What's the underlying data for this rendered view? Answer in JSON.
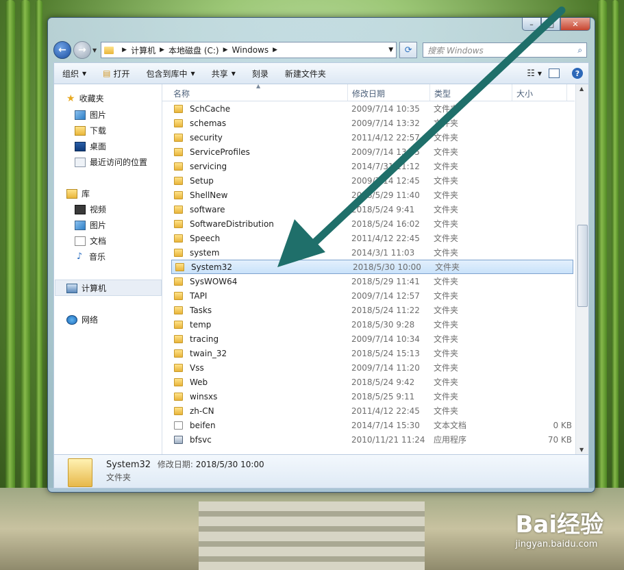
{
  "address": {
    "crumbs": [
      "计算机",
      "本地磁盘 (C:)",
      "Windows"
    ],
    "search_placeholder": "搜索 Windows"
  },
  "toolbar": {
    "organize": "组织",
    "open": "打开",
    "include_library": "包含到库中",
    "share": "共享",
    "burn": "刻录",
    "new_folder": "新建文件夹"
  },
  "nav": {
    "favorites": "收藏夹",
    "pictures": "图片",
    "downloads": "下载",
    "desktop": "桌面",
    "recent": "最近访问的位置",
    "libraries": "库",
    "videos": "视频",
    "lib_pictures": "图片",
    "documents": "文档",
    "music": "音乐",
    "computer": "计算机",
    "network": "网络"
  },
  "columns": {
    "name": "名称",
    "date": "修改日期",
    "type": "类型",
    "size": "大小"
  },
  "files": [
    {
      "name": "SchCache",
      "date": "2009/7/14 10:35",
      "type": "文件夹",
      "size": ""
    },
    {
      "name": "schemas",
      "date": "2009/7/14 13:32",
      "type": "文件夹",
      "size": ""
    },
    {
      "name": "security",
      "date": "2011/4/12 22:57",
      "type": "文件夹",
      "size": ""
    },
    {
      "name": "ServiceProfiles",
      "date": "2009/7/14 13:45",
      "type": "文件夹",
      "size": ""
    },
    {
      "name": "servicing",
      "date": "2014/7/31 11:12",
      "type": "文件夹",
      "size": ""
    },
    {
      "name": "Setup",
      "date": "2009/7/14 12:45",
      "type": "文件夹",
      "size": ""
    },
    {
      "name": "ShellNew",
      "date": "2018/5/29 11:40",
      "type": "文件夹",
      "size": ""
    },
    {
      "name": "software",
      "date": "2018/5/24 9:41",
      "type": "文件夹",
      "size": ""
    },
    {
      "name": "SoftwareDistribution",
      "date": "2018/5/24 16:02",
      "type": "文件夹",
      "size": ""
    },
    {
      "name": "Speech",
      "date": "2011/4/12 22:45",
      "type": "文件夹",
      "size": ""
    },
    {
      "name": "system",
      "date": "2014/3/1 11:03",
      "type": "文件夹",
      "size": ""
    },
    {
      "name": "System32",
      "date": "2018/5/30 10:00",
      "type": "文件夹",
      "size": ""
    },
    {
      "name": "SysWOW64",
      "date": "2018/5/29 11:41",
      "type": "文件夹",
      "size": ""
    },
    {
      "name": "TAPI",
      "date": "2009/7/14 12:57",
      "type": "文件夹",
      "size": ""
    },
    {
      "name": "Tasks",
      "date": "2018/5/24 11:22",
      "type": "文件夹",
      "size": ""
    },
    {
      "name": "temp",
      "date": "2018/5/30 9:28",
      "type": "文件夹",
      "size": ""
    },
    {
      "name": "tracing",
      "date": "2009/7/14 10:34",
      "type": "文件夹",
      "size": ""
    },
    {
      "name": "twain_32",
      "date": "2018/5/24 15:13",
      "type": "文件夹",
      "size": ""
    },
    {
      "name": "Vss",
      "date": "2009/7/14 11:20",
      "type": "文件夹",
      "size": ""
    },
    {
      "name": "Web",
      "date": "2018/5/24 9:42",
      "type": "文件夹",
      "size": ""
    },
    {
      "name": "winsxs",
      "date": "2018/5/25 9:11",
      "type": "文件夹",
      "size": ""
    },
    {
      "name": "zh-CN",
      "date": "2011/4/12 22:45",
      "type": "文件夹",
      "size": ""
    },
    {
      "name": "beifen",
      "date": "2014/7/14 15:30",
      "type": "文本文档",
      "size": "0 KB"
    },
    {
      "name": "bfsvc",
      "date": "2010/11/21 11:24",
      "type": "应用程序",
      "size": "70 KB"
    }
  ],
  "details": {
    "name": "System32",
    "modified_label": "修改日期:",
    "modified_value": "2018/5/30 10:00",
    "type": "文件夹"
  },
  "watermark": {
    "brand": "Bai经验",
    "url": "jingyan.baidu.com"
  },
  "colors": {
    "arrow": "#1f6f6a",
    "selection": "#c9e2fa"
  }
}
